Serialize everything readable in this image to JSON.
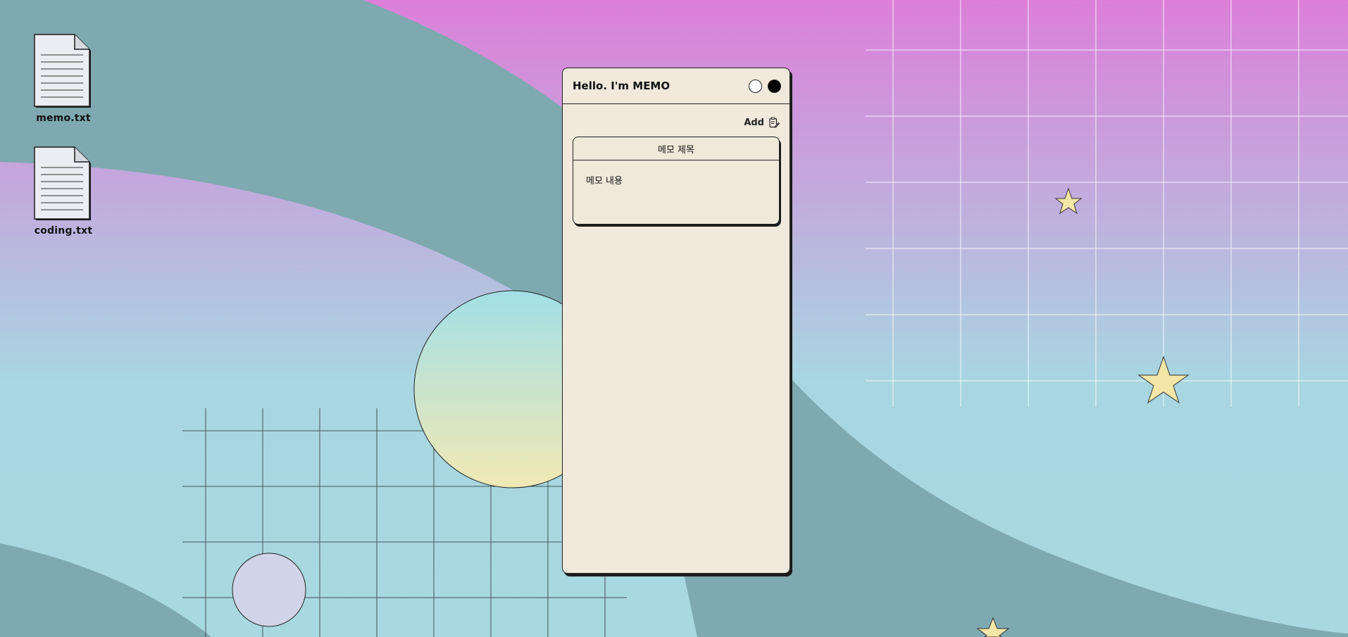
{
  "desktop": {
    "icons": [
      {
        "label": "memo.txt"
      },
      {
        "label": "coding.txt"
      }
    ]
  },
  "window": {
    "title": "Hello. I'm MEMO",
    "add_label": "Add",
    "memos": [
      {
        "title": "메모 제목",
        "content": "메모 내용"
      }
    ]
  },
  "colors": {
    "window_bg": "#f0e9dc",
    "teal_wave": "#7ea9b0",
    "pink_top": "#dc7fd9",
    "light_blue": "#a8d8e0",
    "star_fill": "#f3e6a6"
  }
}
